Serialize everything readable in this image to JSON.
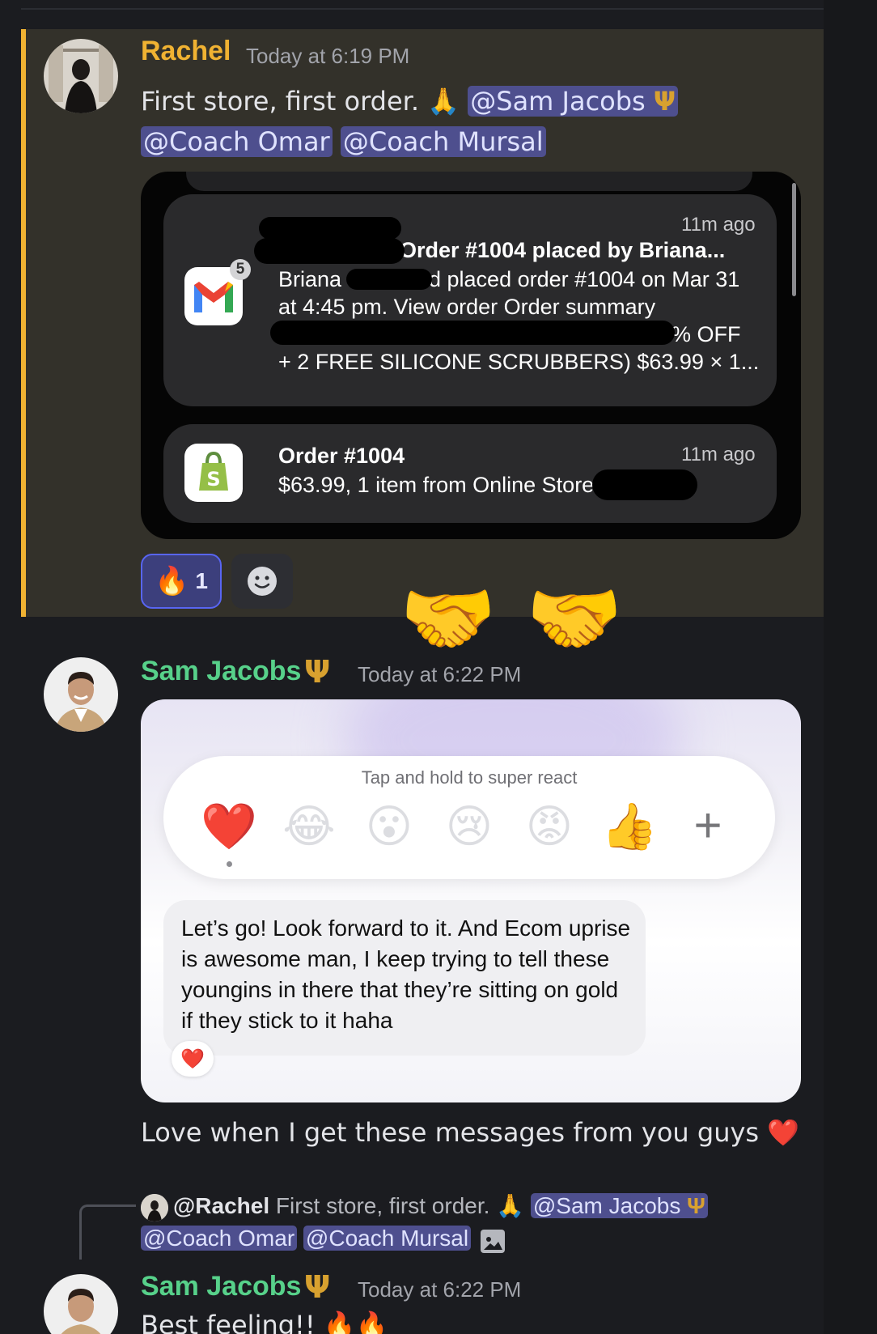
{
  "messages": [
    {
      "author": "Rachel",
      "author_color": "#f0b232",
      "timestamp": "Today at 6:19 PM",
      "text": "First store, first order.",
      "text_emoji": "🙏",
      "mentions": [
        "@Sam Jacobs",
        "@Coach Omar",
        "@Coach Mursal"
      ],
      "highlighted": true,
      "attachment": {
        "notifications": [
          {
            "app": "Gmail",
            "badge": "5",
            "time": "11m ago",
            "title": "Order #1004 placed by Briana...",
            "body_lines": [
              "Briana",
              "d placed order #1004 on Mar 31",
              "at 4:45 pm. View order Order summary",
              "% OFF",
              "+ 2 FREE SILICONE SCRUBBERS) $63.99 × 1..."
            ]
          },
          {
            "app": "Shopify",
            "time": "11m ago",
            "title": "Order #1004",
            "body": "$63.99, 1 item from Online Store ·"
          }
        ]
      },
      "reactions": [
        {
          "emoji": "🔥",
          "count": "1",
          "active": true
        }
      ],
      "add_reaction_icon": "smiley-icon"
    },
    {
      "author": "Sam Jacobs",
      "author_color": "#57d18a",
      "author_badge": "trident-icon",
      "timestamp": "Today at 6:22 PM",
      "overlay_emoji": [
        "🤝",
        "🤝"
      ],
      "attachment": {
        "react_hint": "Tap and hold to super react",
        "react_options": [
          "❤️",
          "😂",
          "😮",
          "😢",
          "😡",
          "👍"
        ],
        "react_more": "+",
        "bubble_text": "Let’s go! Look forward to it. And Ecom uprise is awesome man, I keep trying to tell these youngins in there that they’re sitting on gold if they stick to it haha",
        "bubble_reaction": "❤️"
      },
      "text": "Love when I get these messages from you guys",
      "text_emoji": "❤️"
    },
    {
      "reply_to": {
        "author": "@Rachel",
        "text": "First store, first order.",
        "text_emoji": "🙏",
        "mentions": [
          "@Sam Jacobs",
          "@Coach Omar",
          "@Coach Mursal"
        ],
        "has_image": true
      },
      "author": "Sam Jacobs",
      "author_badge": "trident-icon",
      "timestamp": "Today at 6:22 PM",
      "text": "Best feeling!!",
      "text_emoji": "🔥🔥"
    }
  ]
}
